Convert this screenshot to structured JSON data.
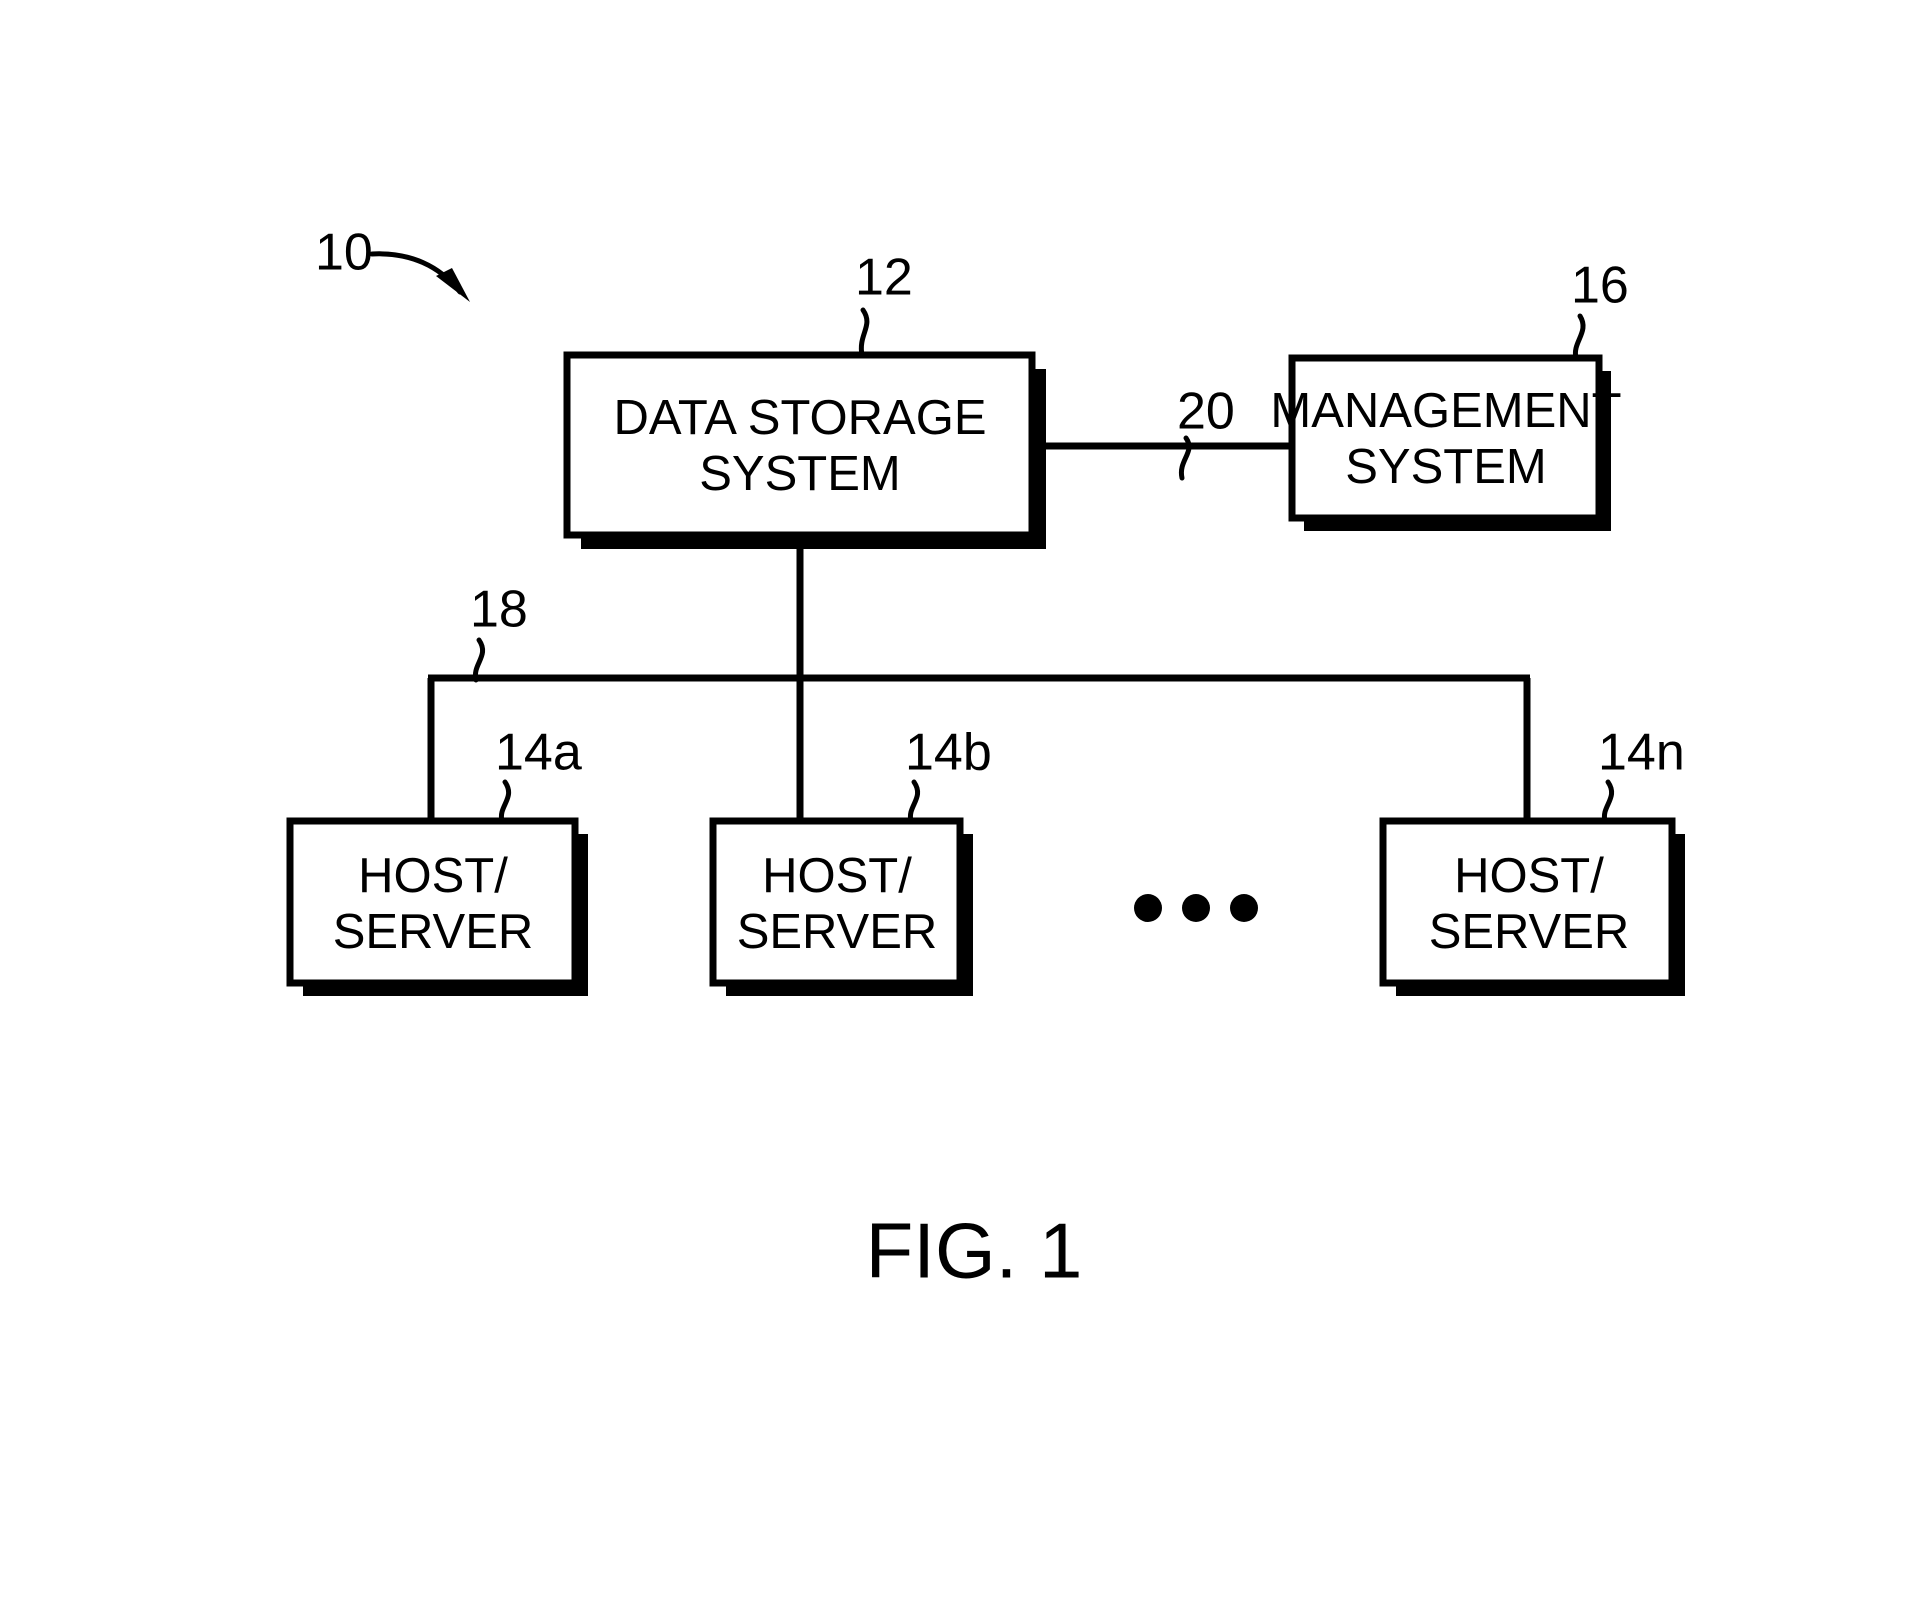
{
  "figure": {
    "caption": "FIG. 1",
    "system_ref": "10"
  },
  "nodes": [
    {
      "id": "data-storage-system",
      "line1": "DATA STORAGE",
      "line2": "SYSTEM",
      "ref": "12"
    },
    {
      "id": "management-system",
      "line1": "MANAGEMENT",
      "line2": "SYSTEM",
      "ref": "16"
    },
    {
      "id": "host-server-a",
      "line1": "HOST/",
      "line2": "SERVER",
      "ref": "14a"
    },
    {
      "id": "host-server-b",
      "line1": "HOST/",
      "line2": "SERVER",
      "ref": "14b"
    },
    {
      "id": "host-server-n",
      "line1": "HOST/",
      "line2": "SERVER",
      "ref": "14n"
    }
  ],
  "connections": [
    {
      "id": "host-bus",
      "ref": "18"
    },
    {
      "id": "management-link",
      "ref": "20"
    }
  ],
  "ellipsis": "• • •",
  "colors": {
    "ink": "#000000",
    "paper": "#ffffff"
  }
}
